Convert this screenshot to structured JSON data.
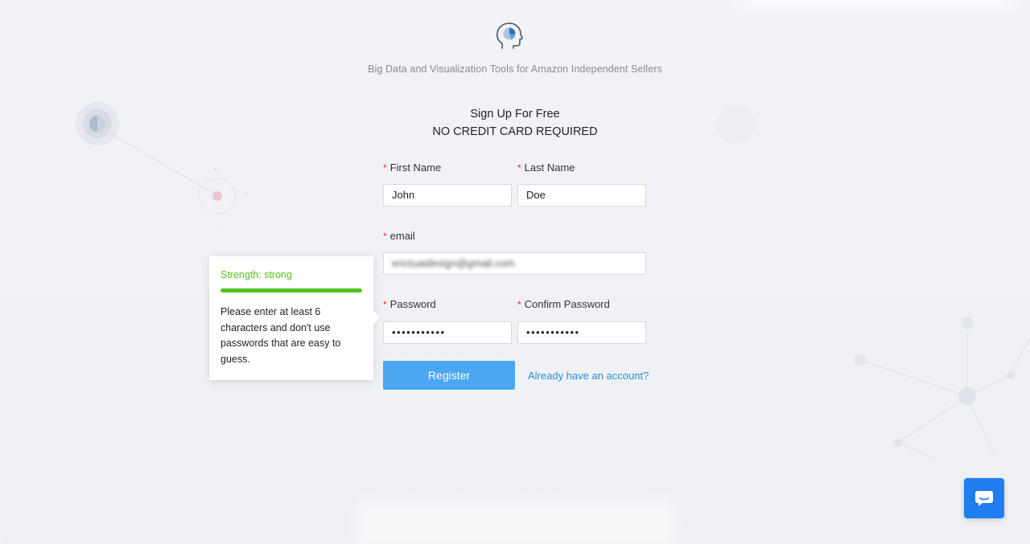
{
  "header": {
    "tagline": "Big Data and Visualization Tools for Amazon Independent Sellers",
    "title_line1": "Sign Up For Free",
    "title_line2": "NO CREDIT CARD REQUIRED"
  },
  "form": {
    "required_mark": "*",
    "first_name": {
      "label": "First Name",
      "value": "John"
    },
    "last_name": {
      "label": "Last Name",
      "value": "Doe"
    },
    "email": {
      "label": "email",
      "value": "erictuaidesign@gmail.com"
    },
    "password": {
      "label": "Password",
      "value": "•••••••••••"
    },
    "confirm_password": {
      "label": "Confirm Password",
      "value": "•••••••••••"
    },
    "register_label": "Register",
    "login_link": "Already have an account?"
  },
  "password_tooltip": {
    "strength_text": "Strength: strong",
    "strength_level": 1.0,
    "message": "Please enter at least 6 characters and don't use passwords that are easy to guess.",
    "strength_color": "#52c41a"
  },
  "colors": {
    "accent": "#4ba7f2",
    "link": "#2b8fd6",
    "chat": "#1e7ef0",
    "required": "#f5222d"
  },
  "icons": {
    "logo": "head-pie-chart-icon",
    "chat": "chat-bubble-icon"
  }
}
